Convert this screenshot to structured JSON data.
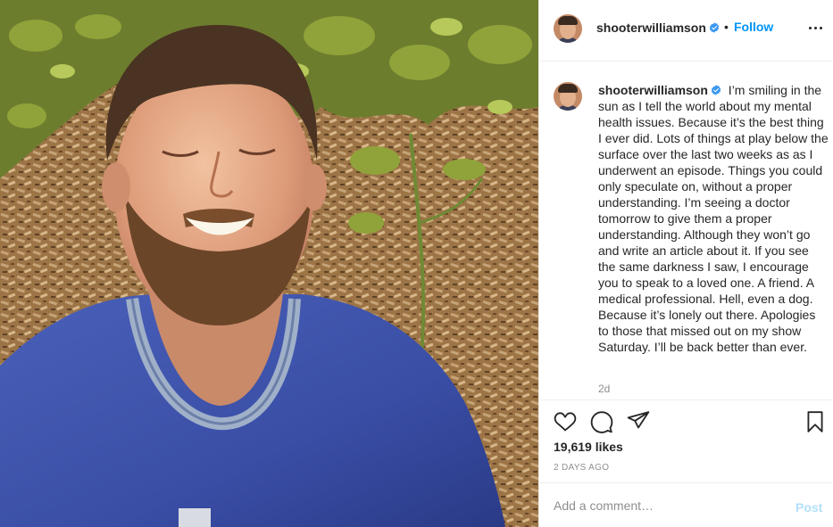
{
  "header": {
    "username": "shooterwilliamson",
    "verified_icon": "verified-badge-icon",
    "separator": "•",
    "follow_label": "Follow",
    "more_icon": "more-options-icon"
  },
  "caption": {
    "username": "shooterwilliamson",
    "text": "I’m smiling in the sun as I tell the world about my mental health issues. Because it’s the best thing I ever did. Lots of things at play below the surface over the last two weeks as as I underwent an episode. Things you could only speculate on, without a proper understanding. I’m seeing a doctor tomorrow to give them a proper understanding. Although they won’t go and write an article about it. If you see the same darkness I saw, I encourage you to speak to a loved one. A friend. A medical professional. Hell, even a dog. Because it’s lonely out there. Apologies to those that missed out on my show Saturday. I’ll be back better than ever.",
    "time_ago": "2d"
  },
  "actions": {
    "icons": [
      "heart-icon",
      "comment-icon",
      "share-icon",
      "bookmark-icon"
    ],
    "likes": "19,619 likes",
    "date": "2 DAYS AGO"
  },
  "comment": {
    "placeholder": "Add a comment…",
    "post_label": "Post"
  },
  "colors": {
    "accent": "#0095f6",
    "post_disabled": "#b2dffc",
    "muted": "#8e8e8e",
    "text": "#262626",
    "border": "#efefef"
  }
}
